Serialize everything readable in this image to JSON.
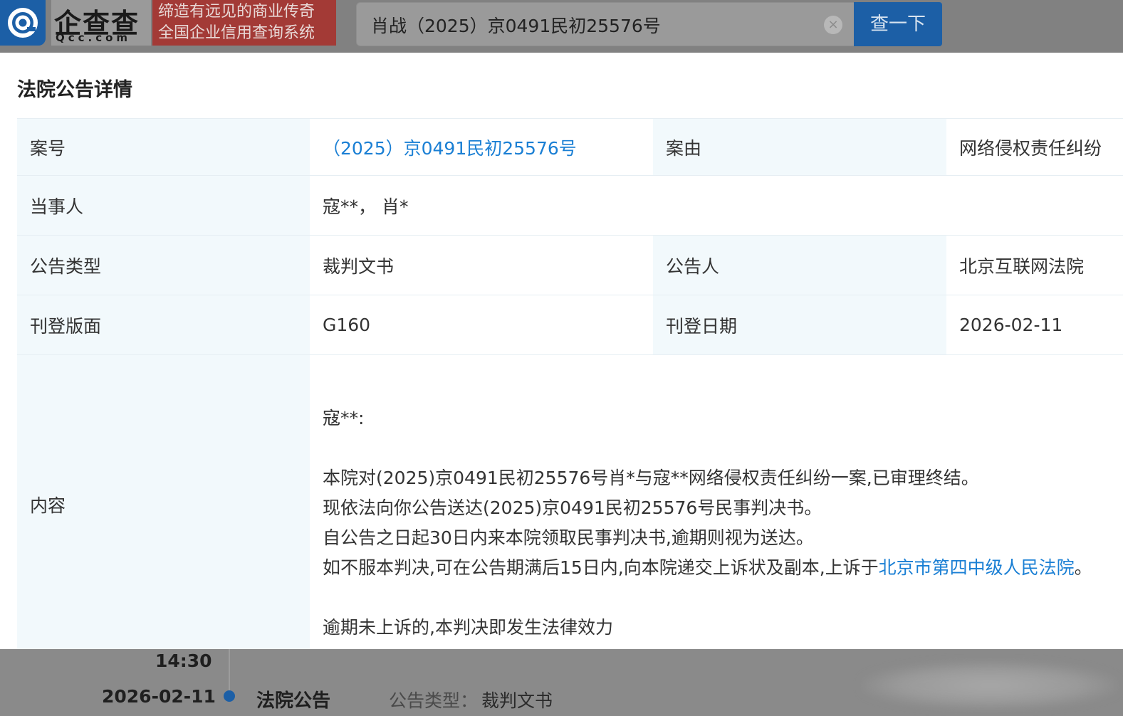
{
  "header": {
    "logo_name": "企查查",
    "logo_domain": "Qcc.com",
    "slogan_line1": "缔造有远见的商业传奇",
    "slogan_line2": "全国企业信用查询系统",
    "search_value": "肖战（2025）京0491民初25576号",
    "search_button": "查一下",
    "clear_icon": "ⓧ"
  },
  "panel": {
    "title": "法院公告详情",
    "rows": {
      "case_no_label": "案号",
      "case_no_value": "（2025）京0491民初25576号",
      "cause_label": "案由",
      "cause_value": "网络侵权责任纠纷",
      "parties_label": "当事人",
      "parties_value": "寇**，  肖*",
      "type_label": "公告类型",
      "type_value": "裁判文书",
      "announcer_label": "公告人",
      "announcer_value": "北京互联网法院",
      "page_label": "刊登版面",
      "page_value": "G160",
      "date_label": "刊登日期",
      "date_value": "2026-02-11",
      "content_label": "内容"
    },
    "content": {
      "greeting": "寇**:",
      "line1": "本院对(2025)京0491民初25576号肖*与寇**网络侵权责任纠纷一案,已审理终结。",
      "line2": "现依法向你公告送达(2025)京0491民初25576号民事判决书。",
      "line3": "自公告之日起30日内来本院领取民事判决书,逾期则视为送达。",
      "line4_prefix": "如不服本判决,可在公告期满后15日内,向本院递交上诉状及副本,上诉于",
      "line4_link": "北京市第四中级人民法院",
      "line4_suffix": "。",
      "line5": "逾期未上诉的,本判决即发生法律效力"
    }
  },
  "timeline": {
    "time": "14:30",
    "date": "2026-02-11",
    "title": "法院公告",
    "type_label": "公告类型：",
    "type_value": "裁判文书"
  },
  "colors": {
    "brand_blue": "#1c5fa6",
    "link_blue": "#1a7fd4",
    "label_bg": "#f2f9fc",
    "slogan_red": "#a33a36"
  }
}
